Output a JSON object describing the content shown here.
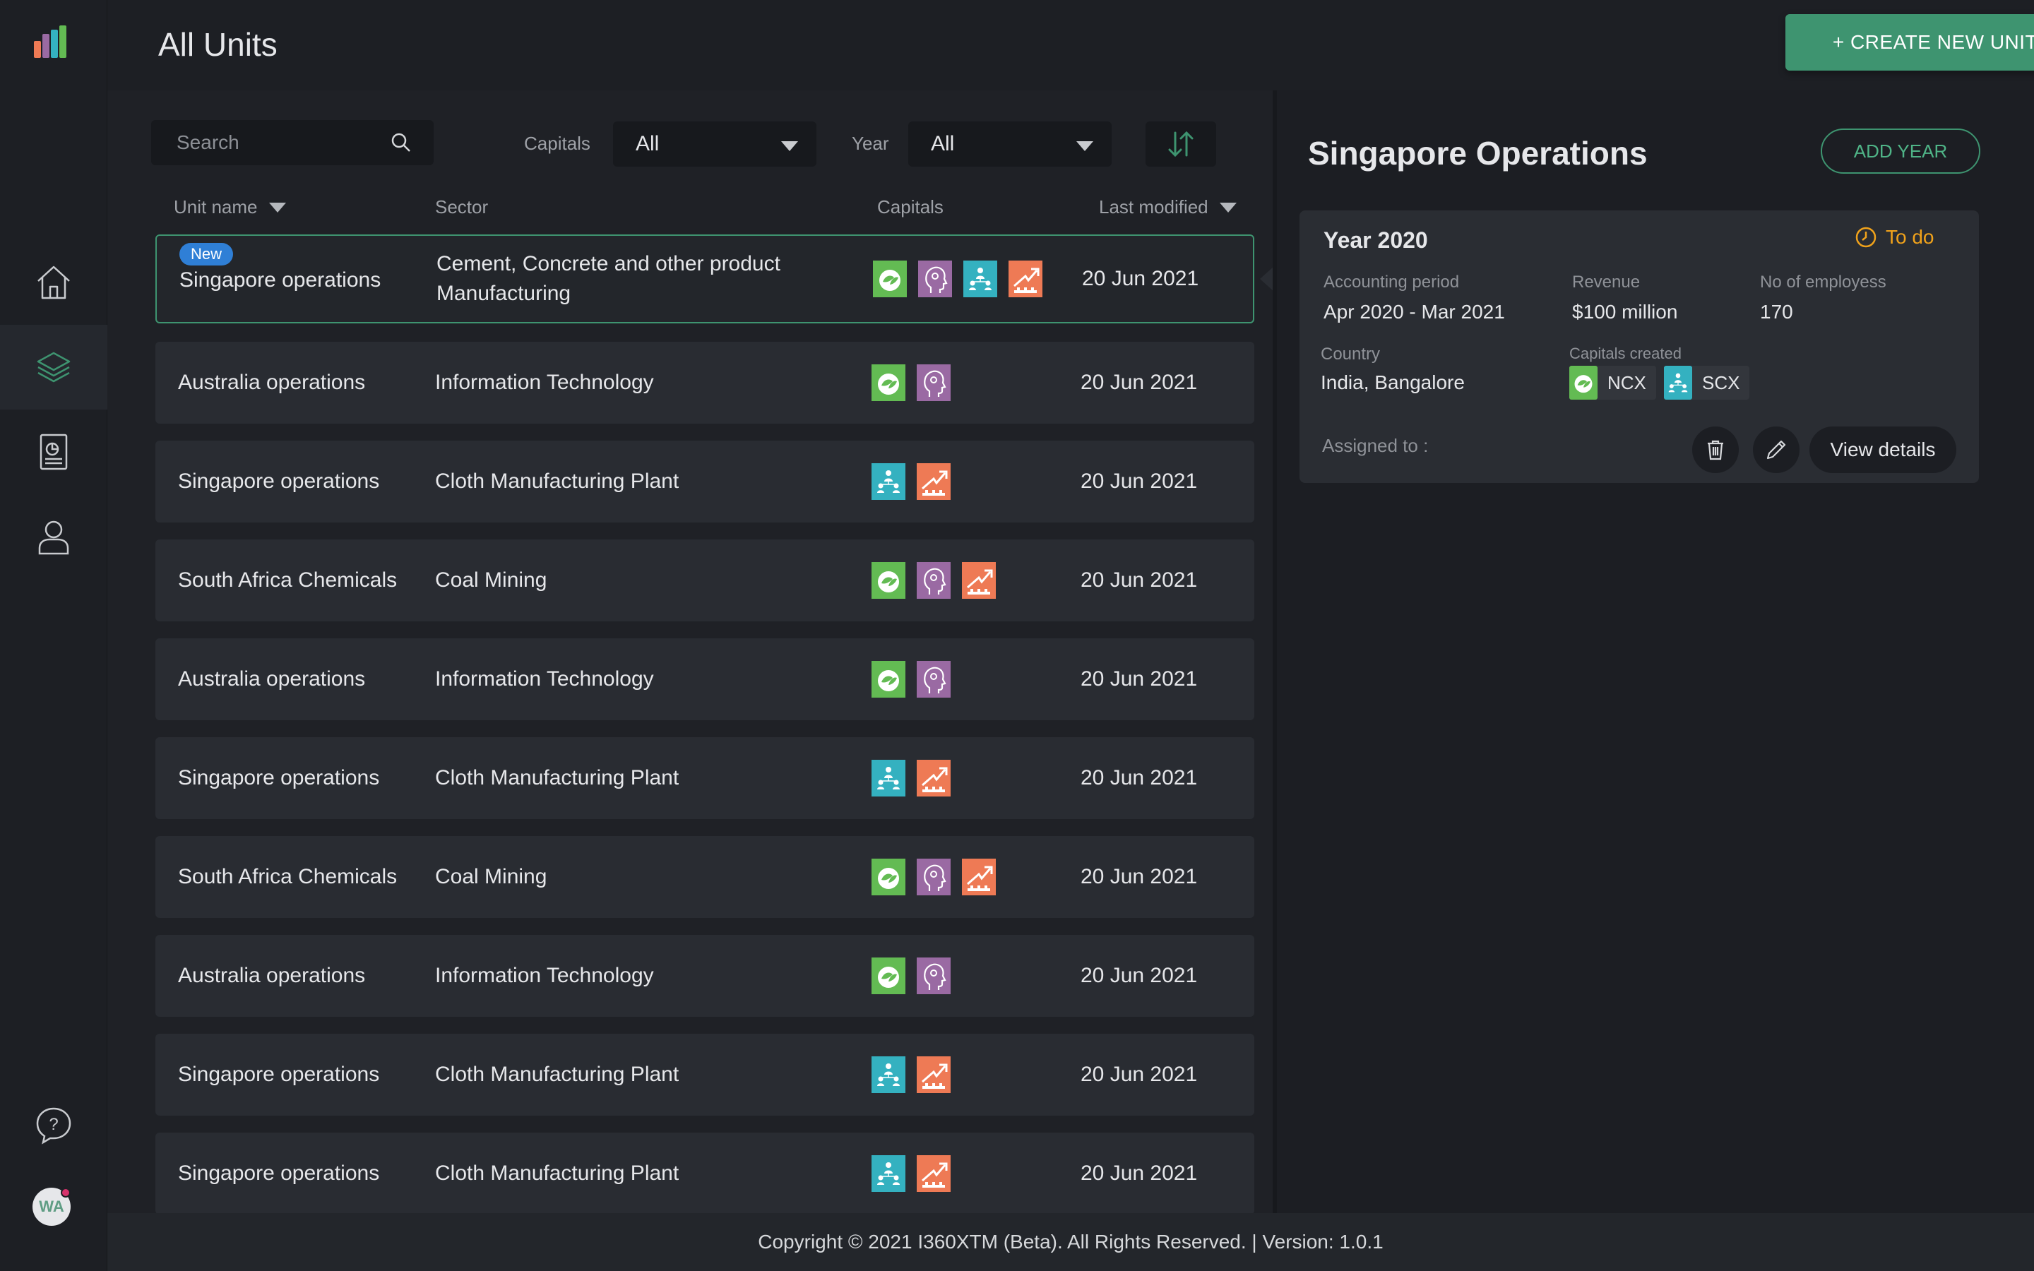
{
  "header": {
    "title": "All Units",
    "create_button": "+ CREATE NEW UNIT"
  },
  "sidebar": {
    "items": [
      {
        "name": "home",
        "icon": "home-icon"
      },
      {
        "name": "units",
        "icon": "layers-icon",
        "active": true
      },
      {
        "name": "reports",
        "icon": "report-icon"
      },
      {
        "name": "profile",
        "icon": "user-icon"
      }
    ],
    "help_icon": "help-icon",
    "avatar_initials": "WA"
  },
  "filters": {
    "search_placeholder": "Search",
    "capitals_label": "Capitals",
    "capitals_value": "All",
    "year_label": "Year",
    "year_value": "All"
  },
  "table": {
    "columns": [
      "Unit name",
      "Sector",
      "Capitals",
      "Last modified"
    ],
    "rows": [
      {
        "name": "Singapore operations",
        "sector": "Cement, Concrete and other product Manufacturing",
        "capitals": [
          "ncx",
          "hcx",
          "scx",
          "fcx"
        ],
        "date": "20 Jun 2021",
        "badge": "New"
      },
      {
        "name": "Australia operations",
        "sector": "Information Technology",
        "capitals": [
          "ncx",
          "hcx"
        ],
        "date": "20 Jun 2021"
      },
      {
        "name": "Singapore operations",
        "sector": "Cloth Manufacturing Plant",
        "capitals": [
          "scx",
          "fcx"
        ],
        "date": "20 Jun 2021"
      },
      {
        "name": "South Africa Chemicals",
        "sector": "Coal Mining",
        "capitals": [
          "ncx",
          "hcx",
          "fcx"
        ],
        "date": "20 Jun 2021"
      },
      {
        "name": "Australia operations",
        "sector": "Information Technology",
        "capitals": [
          "ncx",
          "hcx"
        ],
        "date": "20 Jun 2021"
      },
      {
        "name": "Singapore operations",
        "sector": "Cloth Manufacturing Plant",
        "capitals": [
          "scx",
          "fcx"
        ],
        "date": "20 Jun 2021"
      },
      {
        "name": "South Africa Chemicals",
        "sector": "Coal Mining",
        "capitals": [
          "ncx",
          "hcx",
          "fcx"
        ],
        "date": "20 Jun 2021"
      },
      {
        "name": "Australia operations",
        "sector": "Information Technology",
        "capitals": [
          "ncx",
          "hcx"
        ],
        "date": "20 Jun 2021"
      },
      {
        "name": "Singapore operations",
        "sector": "Cloth Manufacturing Plant",
        "capitals": [
          "scx",
          "fcx"
        ],
        "date": "20 Jun 2021"
      },
      {
        "name": "Singapore operations",
        "sector": "Cloth Manufacturing Plant",
        "capitals": [
          "scx",
          "fcx"
        ],
        "date": "20 Jun 2021"
      }
    ]
  },
  "detail": {
    "title": "Singapore Operations",
    "add_year_button": "ADD YEAR",
    "card": {
      "year_title": "Year 2020",
      "status": "To do",
      "accounting_period_label": "Accounting period",
      "accounting_period_value": "Apr 2020 - Mar 2021",
      "revenue_label": "Revenue",
      "revenue_value": "$100 million",
      "employees_label": "No of employess",
      "employees_value": "170",
      "country_label": "Country",
      "country_value": "India, Bangalore",
      "capitals_label": "Capitals created",
      "capitals_created": [
        {
          "code": "ncx",
          "label": "NCX"
        },
        {
          "code": "scx",
          "label": "SCX"
        }
      ],
      "assigned_label": "Assigned to :",
      "view_button": "View details"
    }
  },
  "footer": {
    "text": "Copyright © 2021 I360XTM (Beta). All Rights Reserved. | Version: 1.0.1"
  },
  "colors": {
    "accent": "#3e9470",
    "status_todo": "#f0a21b",
    "badge_new": "#2f7fd6",
    "ncx": "#63bb53",
    "hcx": "#9a6aa3",
    "scx": "#34b1c0",
    "fcx": "#ee7a55"
  }
}
